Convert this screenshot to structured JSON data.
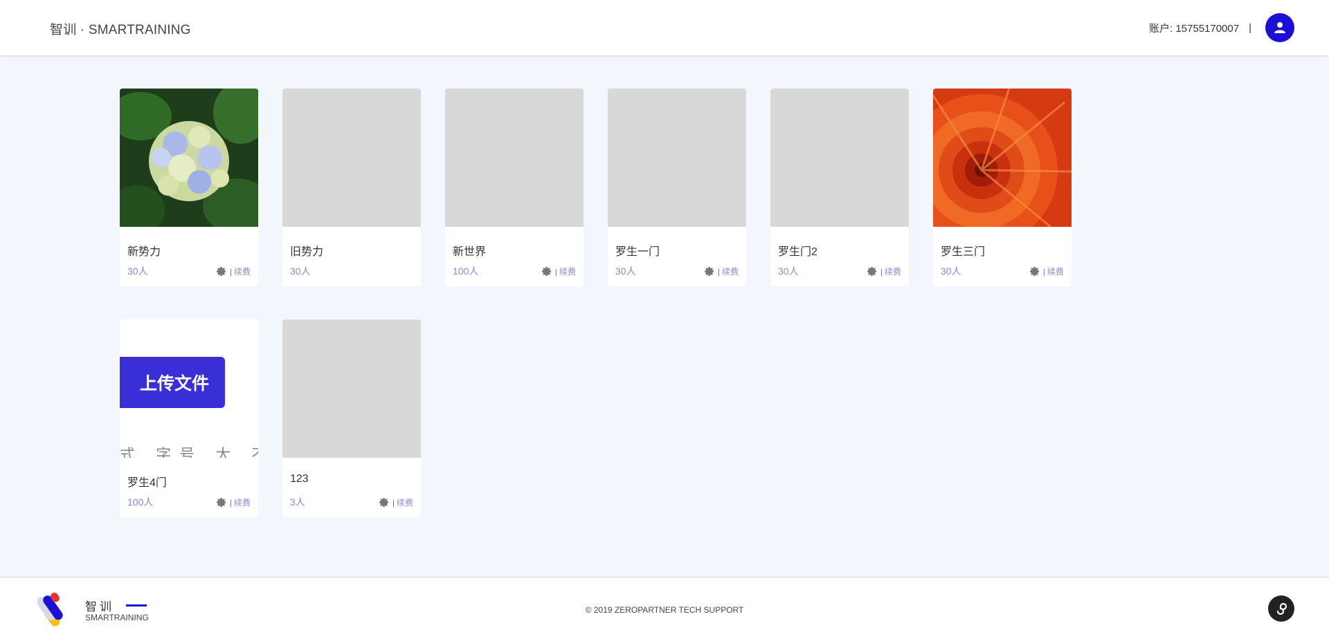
{
  "header": {
    "brand": "智训 · SMARTRAINING",
    "account_label": "账户: 15755170007",
    "separator": "|",
    "avatar_icon": "user-icon"
  },
  "colors": {
    "accent": "#1c0fd6",
    "count_text": "#8a86d9",
    "page_bg": "#f3f6fd",
    "placeholder": "#d8d8d8"
  },
  "cards": [
    {
      "title": "新势力",
      "count": "30人",
      "image": "hydrangea-photo",
      "has_actions": true
    },
    {
      "title": "旧势力",
      "count": "30人",
      "image": "placeholder",
      "has_actions": false
    },
    {
      "title": "新世界",
      "count": "100人",
      "image": "placeholder",
      "has_actions": true
    },
    {
      "title": "罗生一门",
      "count": "30人",
      "image": "placeholder",
      "has_actions": true
    },
    {
      "title": "罗生门2",
      "count": "30人",
      "image": "placeholder",
      "has_actions": true
    },
    {
      "title": "罗生三门",
      "count": "30人",
      "image": "chrysanthemum-photo",
      "has_actions": true
    },
    {
      "title": "罗生4门",
      "count": "100人",
      "image": "upload-screenshot",
      "has_actions": true
    },
    {
      "title": "123",
      "count": "3人",
      "image": "placeholder",
      "has_actions": true
    }
  ],
  "card_actions": {
    "settings_icon": "gear-icon",
    "divider": "|",
    "renew_label": "续费"
  },
  "upload_thumb": {
    "button_text": "上传文件",
    "cut_text": "式 字号 大 不 "
  },
  "footer": {
    "logo_cn": "智训",
    "logo_en": "SMARTRAINING",
    "copyright": "© 2019 ZEROPARTNER TECH SUPPORT",
    "mini_program_icon": "mini-program-icon"
  }
}
